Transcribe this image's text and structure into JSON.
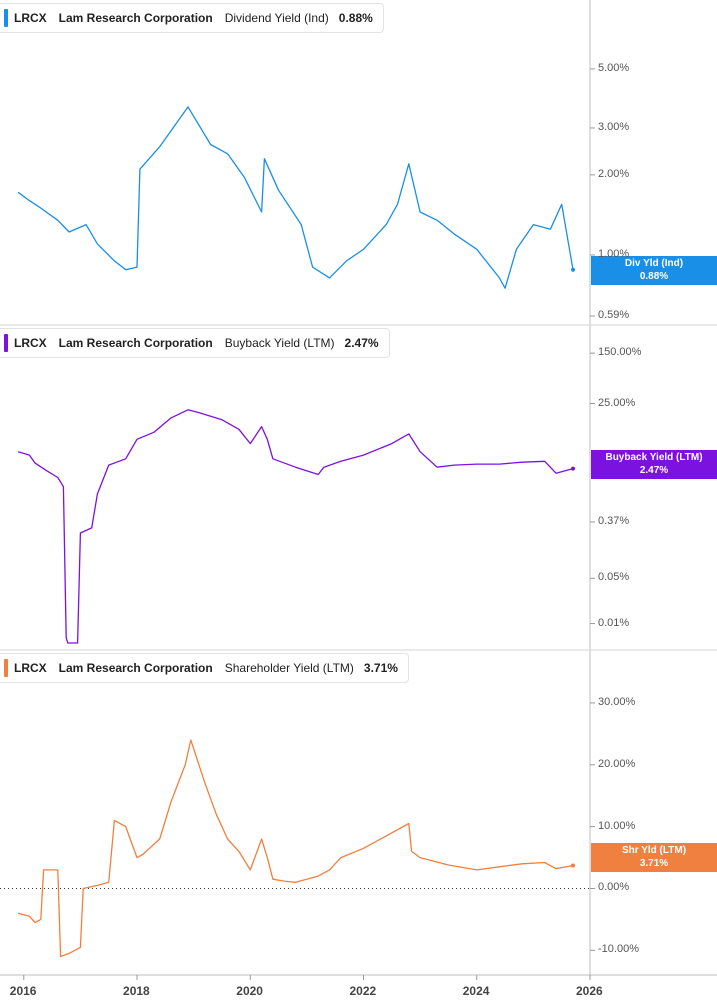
{
  "chart_data": [
    {
      "type": "line",
      "ticker": "LRCX",
      "company": "Lam Research Corporation",
      "metric": "Dividend Yield (Ind)",
      "current_value": "0.88%",
      "tag_label": "Div Yld (Ind)",
      "color": "#1a8fe8",
      "yscale": "log",
      "y_ticks": [
        "5.00%",
        "3.00%",
        "2.00%",
        "1.00%",
        "0.59%"
      ],
      "y_tick_values": [
        5.0,
        3.0,
        2.0,
        1.0,
        0.59
      ],
      "ylim": [
        0.56,
        7.0
      ],
      "series": [
        {
          "x": [
            2015.9,
            2016.1,
            2016.3,
            2016.6,
            2016.8,
            2017.1,
            2017.3,
            2017.6,
            2017.8,
            2018.0,
            2018.05,
            2018.4,
            2018.9,
            2019.3,
            2019.6,
            2019.9,
            2020.2,
            2020.25,
            2020.5,
            2020.9,
            2021.1,
            2021.4,
            2021.7,
            2022.0,
            2022.4,
            2022.6,
            2022.8,
            2023.0,
            2023.3,
            2023.6,
            2024.0,
            2024.4,
            2024.5,
            2024.7,
            2025.0,
            2025.3,
            2025.5,
            2025.7
          ],
          "y": [
            1.72,
            1.6,
            1.5,
            1.35,
            1.22,
            1.3,
            1.1,
            0.95,
            0.88,
            0.9,
            2.1,
            2.55,
            3.6,
            2.6,
            2.4,
            1.95,
            1.45,
            2.3,
            1.75,
            1.3,
            0.9,
            0.82,
            0.95,
            1.05,
            1.3,
            1.55,
            2.2,
            1.45,
            1.35,
            1.2,
            1.05,
            0.82,
            0.75,
            1.05,
            1.3,
            1.25,
            1.55,
            0.88
          ]
        }
      ]
    },
    {
      "type": "line",
      "ticker": "LRCX",
      "company": "Lam Research Corporation",
      "metric": "Buyback Yield (LTM)",
      "current_value": "2.47%",
      "tag_label": "Buyback Yield (LTM)",
      "color": "#7b12e0",
      "yscale": "log",
      "y_ticks": [
        "150.00%",
        "25.00%",
        "0.37%",
        "0.05%",
        "0.01%"
      ],
      "y_tick_values": [
        150.0,
        25.0,
        0.37,
        0.05,
        0.01
      ],
      "ylim": [
        0.0045,
        180.0
      ],
      "series": [
        {
          "x": [
            2015.9,
            2016.1,
            2016.2,
            2016.4,
            2016.6,
            2016.7,
            2016.75,
            2016.78,
            2016.95,
            2017.0,
            2017.2,
            2017.3,
            2017.5,
            2017.8,
            2018.0,
            2018.3,
            2018.6,
            2018.9,
            2019.1,
            2019.5,
            2019.8,
            2020.0,
            2020.2,
            2020.3,
            2020.4,
            2020.8,
            2021.2,
            2021.3,
            2021.6,
            2022.0,
            2022.5,
            2022.8,
            2023.0,
            2023.3,
            2023.6,
            2024.0,
            2024.4,
            2024.8,
            2025.2,
            2025.4,
            2025.7
          ],
          "y": [
            4.5,
            4.0,
            3.0,
            2.3,
            1.8,
            1.3,
            0.006,
            0.005,
            0.005,
            0.25,
            0.3,
            1.0,
            2.8,
            3.5,
            7.0,
            9.0,
            15.0,
            20.0,
            18.0,
            14.0,
            10.0,
            6.0,
            11.0,
            7.0,
            3.5,
            2.6,
            2.0,
            2.6,
            3.2,
            4.0,
            6.0,
            8.5,
            4.5,
            2.6,
            2.8,
            2.9,
            2.9,
            3.1,
            3.2,
            2.1,
            2.47
          ]
        }
      ]
    },
    {
      "type": "line",
      "ticker": "LRCX",
      "company": "Lam Research Corporation",
      "metric": "Shareholder Yield (LTM)",
      "current_value": "3.71%",
      "tag_label": "Shr Yld (LTM)",
      "color": "#f08040",
      "yscale": "linear",
      "y_ticks": [
        "30.00%",
        "20.00%",
        "10.00%",
        "0.00%",
        "-10.00%"
      ],
      "y_tick_values": [
        30,
        20,
        10,
        0,
        -10
      ],
      "ylim": [
        -13.5,
        35.0
      ],
      "zero_line": true,
      "series": [
        {
          "x": [
            2015.9,
            2016.1,
            2016.2,
            2016.3,
            2016.35,
            2016.5,
            2016.6,
            2016.65,
            2016.8,
            2017.0,
            2017.05,
            2017.3,
            2017.5,
            2017.6,
            2017.8,
            2018.0,
            2018.1,
            2018.4,
            2018.6,
            2018.85,
            2018.95,
            2019.2,
            2019.4,
            2019.6,
            2019.8,
            2020.0,
            2020.2,
            2020.3,
            2020.4,
            2020.6,
            2020.8,
            2021.2,
            2021.4,
            2021.6,
            2022.0,
            2022.4,
            2022.8,
            2022.85,
            2023.0,
            2023.5,
            2024.0,
            2024.4,
            2024.8,
            2025.2,
            2025.4,
            2025.7
          ],
          "y": [
            -4.0,
            -4.5,
            -5.5,
            -5.0,
            3.0,
            3.0,
            3.0,
            -11.0,
            -10.5,
            -9.5,
            0.0,
            0.5,
            1.0,
            11.0,
            10.0,
            5.0,
            5.5,
            8.0,
            14.0,
            20.0,
            24.0,
            17.0,
            12.0,
            8.0,
            6.0,
            3.0,
            8.0,
            5.0,
            1.5,
            1.2,
            1.0,
            2.0,
            3.0,
            5.0,
            6.5,
            8.5,
            10.5,
            6.0,
            5.0,
            3.8,
            3.0,
            3.5,
            4.0,
            4.2,
            3.2,
            3.71
          ]
        }
      ]
    }
  ],
  "x_axis": {
    "ticks": [
      "2016",
      "2018",
      "2020",
      "2022",
      "2024",
      "2026"
    ],
    "tick_values": [
      2016,
      2018,
      2020,
      2022,
      2024,
      2026
    ],
    "xlim": [
      2015.58,
      2026.0
    ]
  }
}
